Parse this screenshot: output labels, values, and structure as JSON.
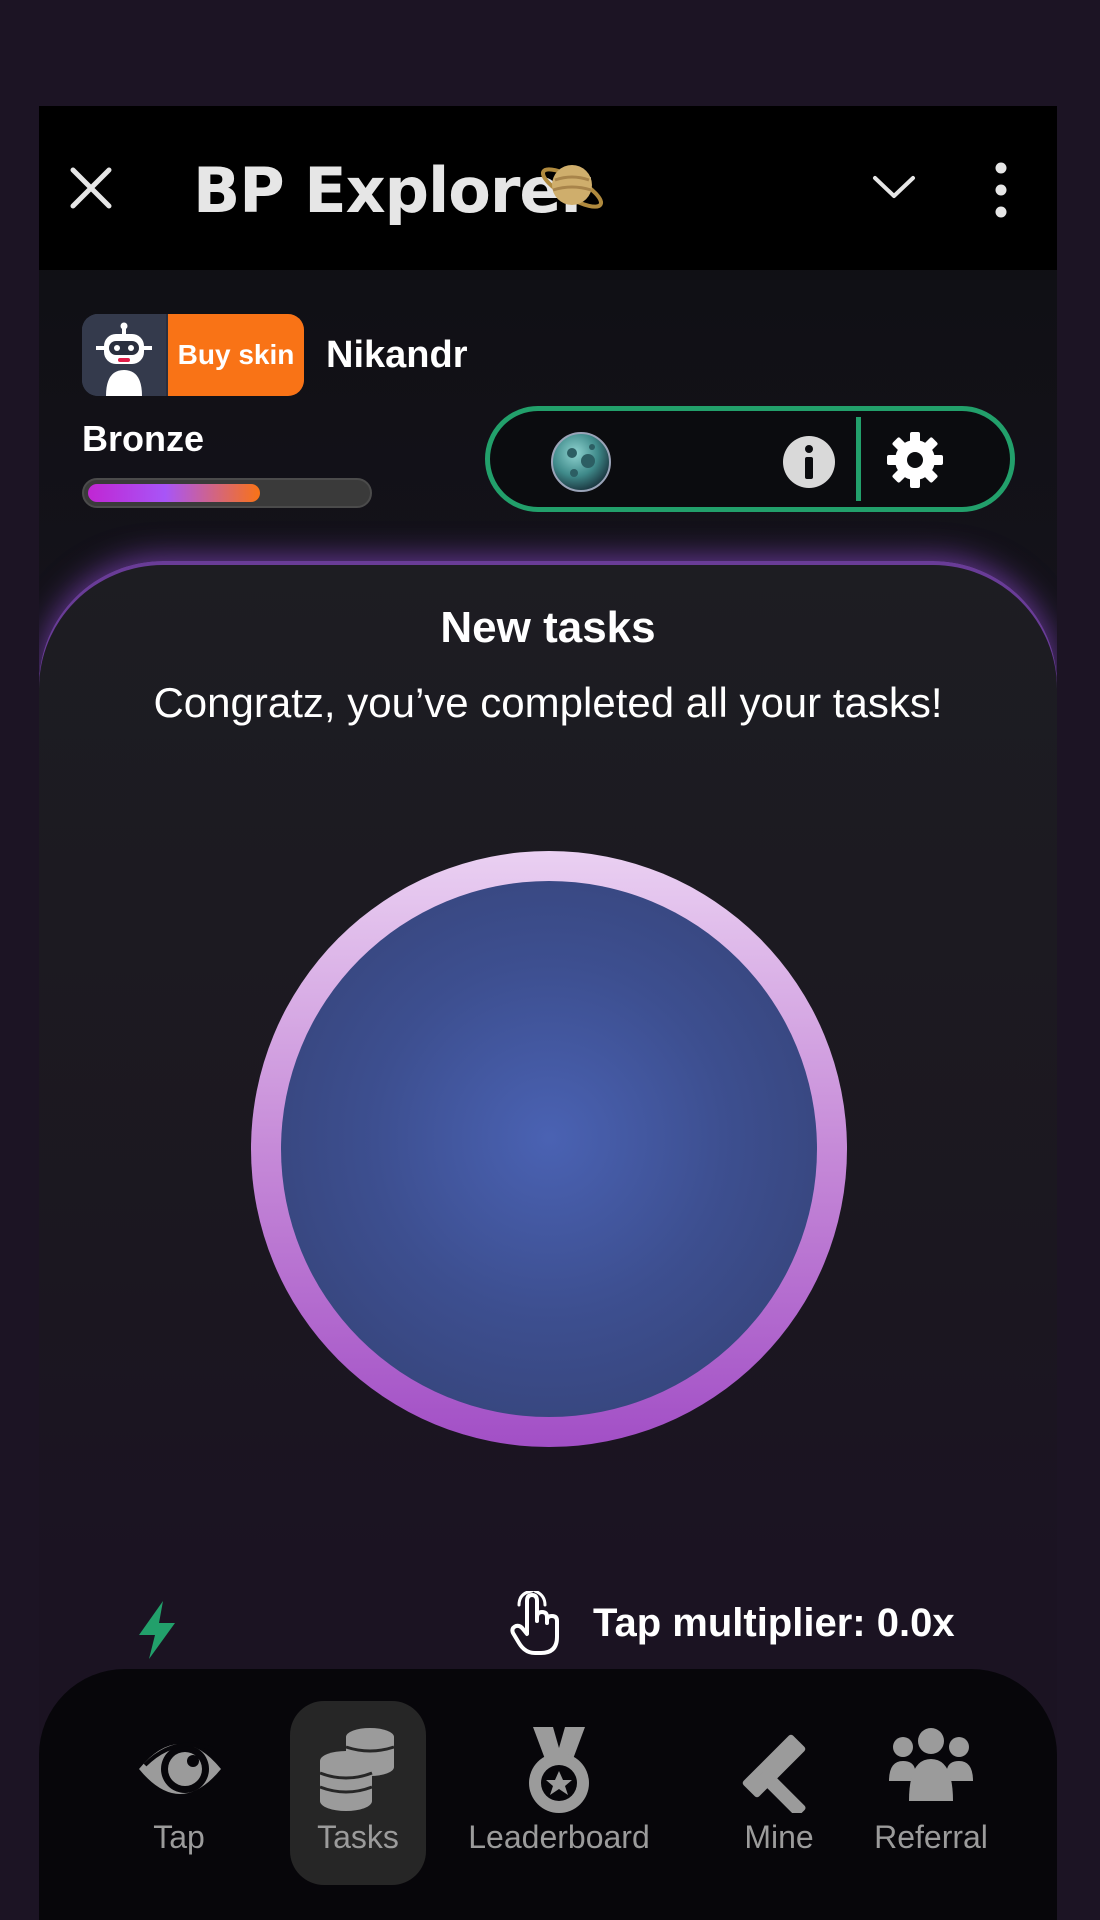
{
  "app": {
    "title": "BP Explorer"
  },
  "profile": {
    "buy_skin_label": "Buy skin",
    "username": "Nikandr",
    "rank": "Bronze",
    "rank_progress": 0.62
  },
  "tasks": {
    "title": "New tasks",
    "message": "Congratz, you’ve completed all your tasks!"
  },
  "stats": {
    "multiplier_label": "Tap multiplier: 0.0x"
  },
  "nav": {
    "items": [
      {
        "label": "Tap",
        "icon": "eye-icon"
      },
      {
        "label": "Tasks",
        "icon": "coins-icon",
        "active": true
      },
      {
        "label": "Leaderboard",
        "icon": "medal-icon"
      },
      {
        "label": "Mine",
        "icon": "hammer-icon"
      },
      {
        "label": "Referral",
        "icon": "users-icon"
      }
    ]
  },
  "colors": {
    "accent_green": "#22a06b",
    "buy_skin": "#f97316",
    "orb_ring": "#c68ad8",
    "orb_core": "#4a62b3"
  }
}
